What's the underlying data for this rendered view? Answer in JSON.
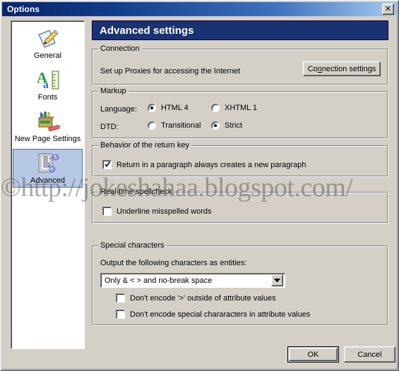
{
  "window": {
    "title": "Options",
    "close_label": "✕"
  },
  "sidebar": {
    "items": [
      {
        "label": "General",
        "icon": "pencil-paper-icon",
        "selected": false
      },
      {
        "label": "Fonts",
        "icon": "font-ruler-icon",
        "selected": false
      },
      {
        "label": "New Page Settings",
        "icon": "crayon-box-icon",
        "selected": false
      },
      {
        "label": "Advanced",
        "icon": "network-switch-icon",
        "selected": true
      }
    ]
  },
  "header": {
    "title": "Advanced settings"
  },
  "groups": {
    "connection": {
      "title": "Connection",
      "description": "Set up Proxies for accessing the Internet",
      "button_pre": "Co",
      "button_accel": "n",
      "button_post": "nection settings"
    },
    "markup": {
      "title": "Markup",
      "language_label": "Language:",
      "dtd_label": "DTD:",
      "language_options": [
        {
          "label": "HTML 4",
          "selected": true
        },
        {
          "label": "XHTML 1",
          "selected": false
        }
      ],
      "dtd_options": [
        {
          "label": "Transitional",
          "selected": false
        },
        {
          "label": "Strict",
          "selected": true
        }
      ]
    },
    "return_key": {
      "title": "Behavior of the return key",
      "checkbox_label": "Return in a paragraph always creates a new paragraph",
      "checked": true
    },
    "spellcheck": {
      "title": "Real-time spellcheck",
      "checkbox_label": "Underline misspelled words",
      "checked": false
    },
    "special_characters": {
      "title": "Special characters",
      "description": "Output the following characters as entities:",
      "selected_option": "Only & < > and no-break space",
      "options": [
        "Only & < > and no-break space"
      ],
      "checkbox1_label": "Don't encode '>' outside of attribute values",
      "checkbox1_checked": false,
      "checkbox2_label": "Don't encode special chararacters in attribute values",
      "checkbox2_checked": false
    }
  },
  "footer": {
    "ok_label": "OK",
    "cancel_label": "Cancel"
  },
  "watermark": {
    "text": "©http://jokeshahaa.blogspot.com/"
  },
  "colors": {
    "dialog_face": "#d4d0c8",
    "title_bar_start": "#0a246a",
    "title_bar_end": "#a6caf0",
    "header_banner": "#1b3272",
    "selection": "#b6c8e4",
    "selection_border": "#4a6fa5"
  }
}
